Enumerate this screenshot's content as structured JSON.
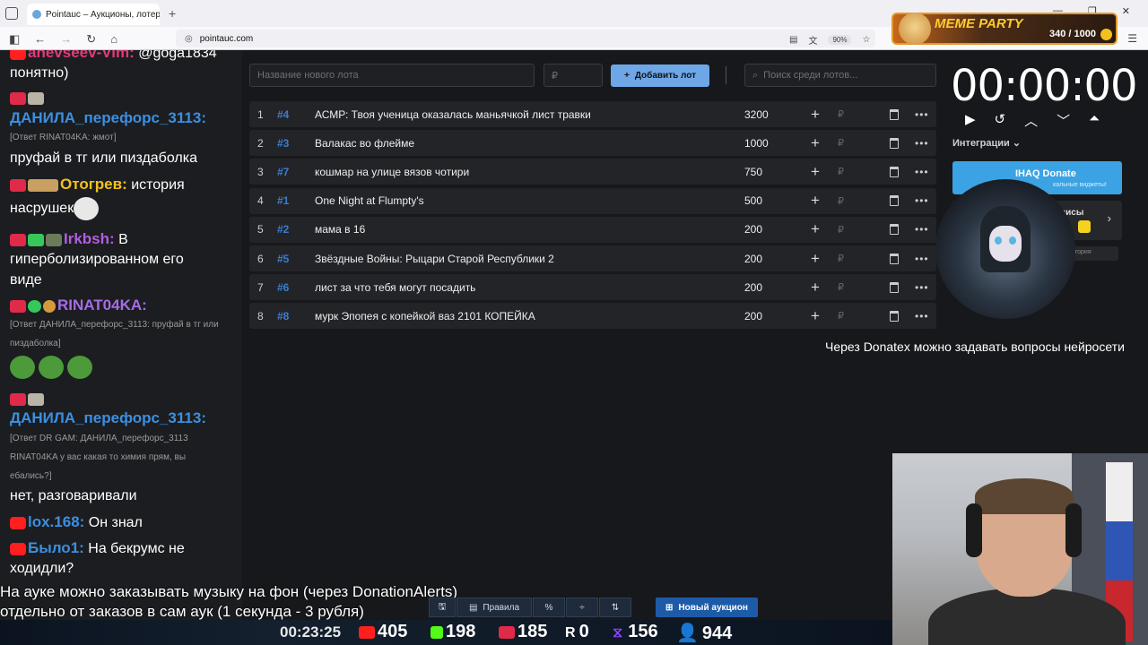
{
  "browser": {
    "tab_title": "Pointauc – Аукционы, лотереи",
    "url": "pointauc.com",
    "zoom": "90%"
  },
  "overlay": {
    "meme_title": "MEME PARTY",
    "meme_count": "340 / 1000"
  },
  "chat": {
    "messages": [
      {
        "nick": "anevseev-Vim:",
        "text": " @goga1834",
        "nick_color": "#e03b7a"
      },
      {
        "text": "понятно)"
      },
      {
        "nick": "ДАНИЛА_перефорс_3113:",
        "nick_color": "#3c8fe0"
      },
      {
        "reply": "[Ответ RINAT04KA: жмот]"
      },
      {
        "text": "пруфай в тг или пиздаболка"
      },
      {
        "nick": "Отогрев:",
        "text": " история",
        "nick_color": "#f2c21c"
      },
      {
        "text": "насрушек"
      },
      {
        "nick": "Irkbsh:",
        "text": " В",
        "nick_color": "#b35ee0"
      },
      {
        "text": "гиперболизированном его"
      },
      {
        "text": "виде"
      },
      {
        "nick": "RINAT04KA:",
        "nick_color": "#a66ce8"
      },
      {
        "reply": "[Ответ ДАНИЛА_перефорс_3113: пруфай в тг или"
      },
      {
        "reply": "пиздаболка]"
      },
      {
        "nick": "ДАНИЛА_перефорс_3113:",
        "nick_color": "#3c8fe0"
      },
      {
        "reply": "[Ответ DR GAM: ДАНИЛА_перефорс_3113"
      },
      {
        "reply": "RINAT04KA у вас какая то химия прям, вы"
      },
      {
        "reply": "ебались?]"
      },
      {
        "text": "нет, разговаривали"
      },
      {
        "nick": "lox.168:",
        "text": " Он знал",
        "nick_color": "#3c8fe0"
      },
      {
        "nick": "Было1:",
        "text": " На бекрумс не",
        "nick_color": "#3c8fe0"
      },
      {
        "text": "ходидли?"
      }
    ]
  },
  "auction": {
    "new_lot_placeholder": "Название нового лота",
    "amount_placeholder": "₽",
    "add_button": "Добавить лот",
    "search_placeholder": "Поиск среди лотов...",
    "lots": [
      {
        "n": "1",
        "id": "#4",
        "name": "АСМР: Твоя ученица оказалась маньячкой лист травки",
        "amount": "3200"
      },
      {
        "n": "2",
        "id": "#3",
        "name": "Валакас во флейме",
        "amount": "1000"
      },
      {
        "n": "3",
        "id": "#7",
        "name": "кошмар на улице вязов чотири",
        "amount": "750"
      },
      {
        "n": "4",
        "id": "#1",
        "name": "One Night at Flumpty's",
        "amount": "500"
      },
      {
        "n": "5",
        "id": "#2",
        "name": "мама в 16",
        "amount": "200"
      },
      {
        "n": "6",
        "id": "#5",
        "name": "Звёздные Войны: Рыцари Старой Республики 2",
        "amount": "200"
      },
      {
        "n": "7",
        "id": "#6",
        "name": "лист за что тебя могут посадить",
        "amount": "200"
      },
      {
        "n": "8",
        "id": "#8",
        "name": "мурк Эпопея с копейкой ваз 2101 КОПЕЙКА",
        "amount": "200"
      }
    ],
    "rub": "₽"
  },
  "right_panel": {
    "timer": "00:00:00",
    "integrations_label": "Интеграции",
    "donate_button": "IHAQ Donate",
    "donate_sub": "кальные виджеты!",
    "services_label": "висы",
    "history_label": "тория"
  },
  "donatex_text": "Через Donatex можно задавать вопросы нейросети",
  "ticker": {
    "line1": "На ауке можно заказывать музыку на фон (через DonationAlerts)",
    "line2": "отдельно от заказов в сам аук (1 секунда - 3 рубля)"
  },
  "toolbar": {
    "rules": "Правила",
    "new_auction": "Новый аукцион"
  },
  "stats": {
    "time": "00:23:25",
    "youtube": "405",
    "kick": "198",
    "live": "185",
    "rumble": "0",
    "twitch": "156",
    "viewers": "944"
  }
}
